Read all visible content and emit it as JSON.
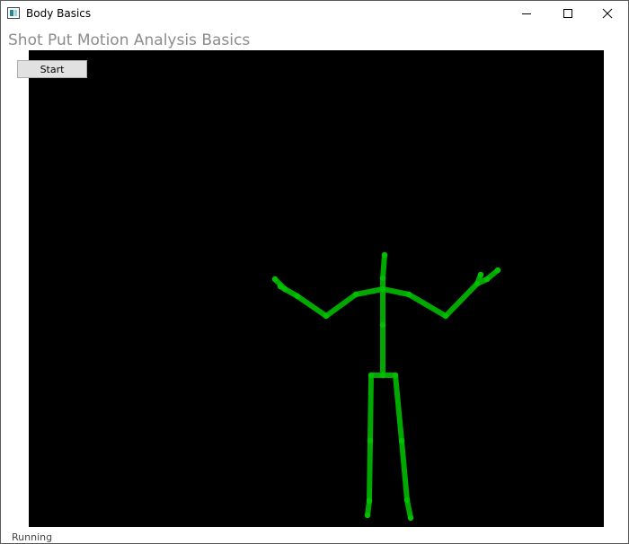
{
  "window": {
    "title": "Body Basics",
    "icon": "app-window-icon",
    "controls": [
      "minimize-icon",
      "maximize-icon",
      "close-icon"
    ]
  },
  "header": {
    "title": "Shot Put Motion Analysis Basics"
  },
  "toolbar": {
    "start_label": "Start"
  },
  "status": {
    "text": "Running"
  },
  "skeleton": {
    "color": "#00a800",
    "joint_color": "#00c000",
    "background": "#000000"
  }
}
